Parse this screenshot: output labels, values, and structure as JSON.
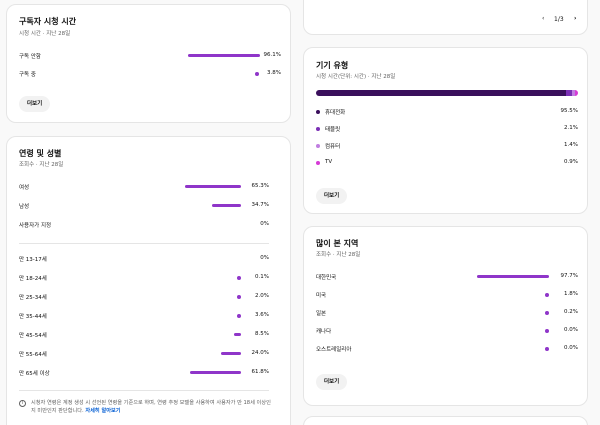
{
  "subscriber_watch_time": {
    "title": "구독자 시청 시간",
    "subtitle": "시청 시간 · 지난 28일",
    "rows": [
      {
        "label": "구독 안함",
        "value": 96.1,
        "display": "96.1%"
      },
      {
        "label": "구독 중",
        "value": 3.8,
        "display": "3.8%"
      }
    ],
    "more_label": "더보기"
  },
  "age_gender": {
    "title": "연령 및 성별",
    "subtitle": "조회수 · 지난 28일",
    "gender_rows": [
      {
        "label": "여성",
        "value": 65.3,
        "display": "65.3%"
      },
      {
        "label": "남성",
        "value": 34.7,
        "display": "34.7%"
      },
      {
        "label": "사용자가 지정",
        "value": 0,
        "display": "0%"
      }
    ],
    "age_rows": [
      {
        "label": "만 13-17세",
        "value": 0,
        "display": "0%"
      },
      {
        "label": "만 18-24세",
        "value": 0.1,
        "display": "0.1%"
      },
      {
        "label": "만 25-34세",
        "value": 2.0,
        "display": "2.0%"
      },
      {
        "label": "만 35-44세",
        "value": 3.6,
        "display": "3.6%"
      },
      {
        "label": "만 45-54세",
        "value": 8.5,
        "display": "8.5%"
      },
      {
        "label": "만 55-64세",
        "value": 24.0,
        "display": "24.0%"
      },
      {
        "label": "만 65세 이상",
        "value": 61.8,
        "display": "61.8%"
      }
    ],
    "note_text": "시청자 연령은 계정 생성 시 선언된 연령을 기준으로 하며, 연령 추정 모델을 사용하여 사용자가 만 18세 이상인지 미만인지 판단합니다.",
    "note_link": "자세히 알아보기"
  },
  "pager": {
    "text": "1/3",
    "prev_icon": "chevron-left-icon",
    "next_icon": "chevron-right-icon"
  },
  "device_type": {
    "title": "기기 유형",
    "subtitle": "시청 시간(단위: 시간) · 지난 28일",
    "items": [
      {
        "label": "휴대전화",
        "value": 95.5,
        "display": "95.5%",
        "color": "#3a0f5c"
      },
      {
        "label": "태블릿",
        "value": 2.1,
        "display": "2.1%",
        "color": "#7b2fb5"
      },
      {
        "label": "컴퓨터",
        "value": 1.4,
        "display": "1.4%",
        "color": "#c07ee0"
      },
      {
        "label": "TV",
        "value": 0.9,
        "display": "0.9%",
        "color": "#d63bd6"
      }
    ],
    "more_label": "더보기"
  },
  "top_regions": {
    "title": "많이 본 지역",
    "subtitle": "조회수 · 지난 28일",
    "rows": [
      {
        "label": "대한민국",
        "value": 97.7,
        "display": "97.7%"
      },
      {
        "label": "미국",
        "value": 1.8,
        "display": "1.8%"
      },
      {
        "label": "일본",
        "value": 0.2,
        "display": "0.2%"
      },
      {
        "label": "캐나다",
        "value": 0.0,
        "display": "0.0%"
      },
      {
        "label": "오스트레일리아",
        "value": 0.0,
        "display": "0.0%"
      }
    ],
    "more_label": "더보기"
  },
  "colors": {
    "accent": "#8f35c9",
    "link": "#065fd4"
  }
}
